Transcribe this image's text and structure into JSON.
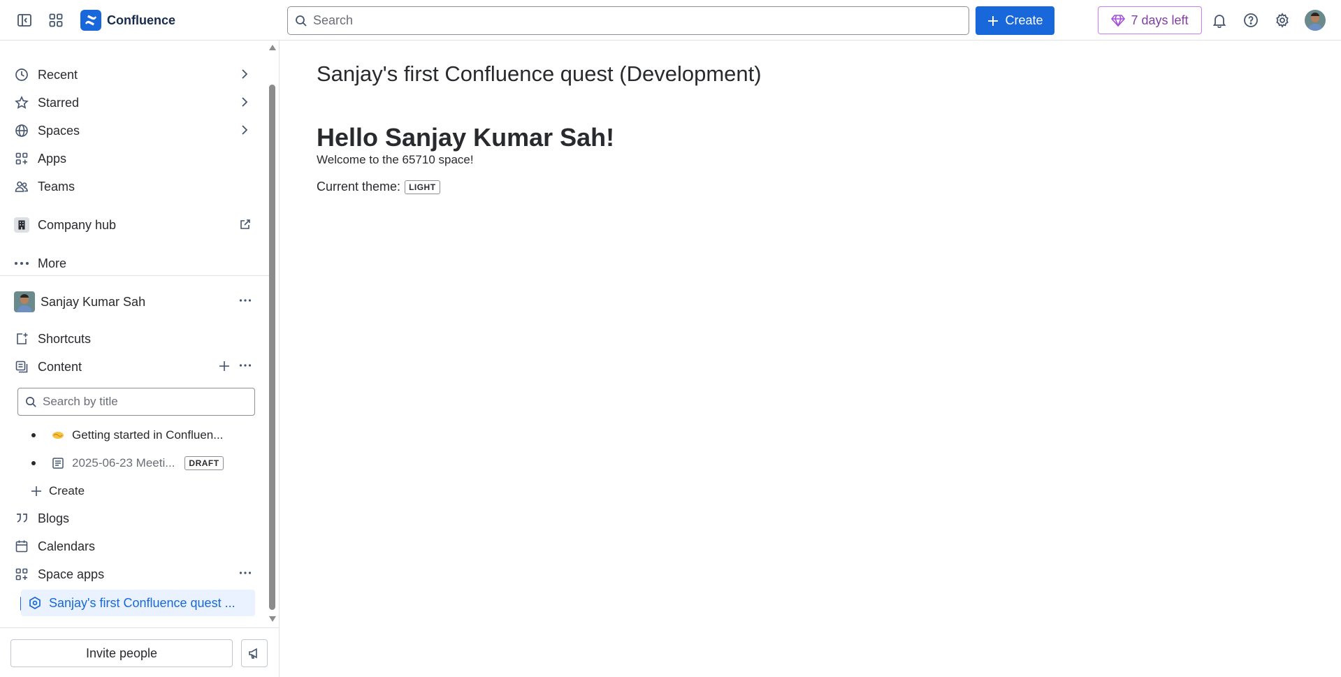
{
  "topbar": {
    "app_name": "Confluence",
    "search_placeholder": "Search",
    "create_label": "Create",
    "trial_label": "7 days left"
  },
  "sidebar": {
    "nav": [
      {
        "label": "Recent",
        "icon": "clock-icon"
      },
      {
        "label": "Starred",
        "icon": "star-icon"
      },
      {
        "label": "Spaces",
        "icon": "globe-icon"
      },
      {
        "label": "Apps",
        "icon": "apps-icon"
      },
      {
        "label": "Teams",
        "icon": "teams-icon"
      }
    ],
    "company_hub": "Company hub",
    "more": "More",
    "user_name": "Sanjay Kumar Sah",
    "shortcuts": "Shortcuts",
    "content": "Content",
    "search_placeholder": "Search by title",
    "tree": [
      {
        "label": "Getting started in Confluen...",
        "icon": "handshake-icon"
      },
      {
        "label": "2025-06-23 Meeti...",
        "icon": "page-icon",
        "badge": "DRAFT"
      }
    ],
    "create": "Create",
    "blogs": "Blogs",
    "calendars": "Calendars",
    "space_apps": "Space apps",
    "active_item": "Sanjay's first Confluence quest ...",
    "invite": "Invite people"
  },
  "main": {
    "page_title": "Sanjay's first Confluence quest (Development)",
    "heading": "Hello Sanjay Kumar Sah!",
    "welcome": "Welcome to the 65710 space!",
    "theme_label": "Current theme:",
    "theme_value": "LIGHT"
  },
  "colors": {
    "brand_blue": "#1868db",
    "trial_purple": "#803fa5",
    "active_bg": "#e9f2fe"
  }
}
